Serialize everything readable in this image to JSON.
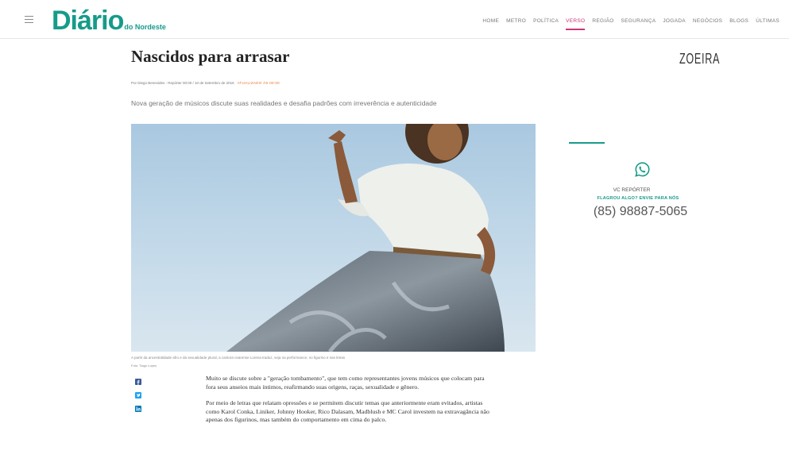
{
  "header": {
    "logo_main": "Diário",
    "logo_sub": "do Nordeste",
    "brand_color": "#169b8a",
    "nav": [
      {
        "label": "HOME",
        "active": false
      },
      {
        "label": "METRO",
        "active": false
      },
      {
        "label": "POLÍTICA",
        "active": false
      },
      {
        "label": "VERSO",
        "active": true
      },
      {
        "label": "REGIÃO",
        "active": false
      },
      {
        "label": "SEGURANÇA",
        "active": false
      },
      {
        "label": "JOGADA",
        "active": false
      },
      {
        "label": "NEGÓCIOS",
        "active": false
      },
      {
        "label": "BLOGS",
        "active": false
      },
      {
        "label": "ÚLTIMAS",
        "active": false
      }
    ],
    "active_color": "#c9367a"
  },
  "article": {
    "title": "Nascidos para arrasar",
    "byline": "Por Diego Benevides - Repórter 00:00 / 10 de Setembro de 2016",
    "updated": "ATUALIZADO ÀS 00:00",
    "lead": "Nova geração de músicos discute suas realidades e desafia padrões com irreverência e autenticidade",
    "photo_caption": "A partir da ancestralidade afro e da sexualidade plural, a cantora cearense Lorena traduz, seja na performance, no figurino e nas letras",
    "photo_credit": "Foto: Tiago Lopes",
    "paragraphs": [
      "Muito se discute sobre a \"geração tombamento\", que tem como representantes jovens músicos que colocam para fora seus anseios mais íntimos, reafirmando suas origens, raças, sexualidade e gênero.",
      "Por meio de letras que relatam opressões e se permitem discutir temas que anteriormente eram evitados, artistas como Karol Conka, Liniker, Johnny Hooker, Rico Dalasam, Madblush e MC Carol investem na extravagância não apenas dos figurinos, mas também do comportamento em cima do palco."
    ],
    "share": [
      {
        "icon": "facebook-icon",
        "color": "#3b5998"
      },
      {
        "icon": "twitter-icon",
        "color": "#1da1f2"
      },
      {
        "icon": "linkedin-icon",
        "color": "#0077b5"
      }
    ]
  },
  "sidebar": {
    "blog_name": "ZOEIRA",
    "reporter_title": "VC REPÓRTER",
    "reporter_sub": "FLAGROU ALGO? ENVIE PARA NÓS",
    "phone": "(85) 98887-5065",
    "icon": "whatsapp-icon"
  }
}
